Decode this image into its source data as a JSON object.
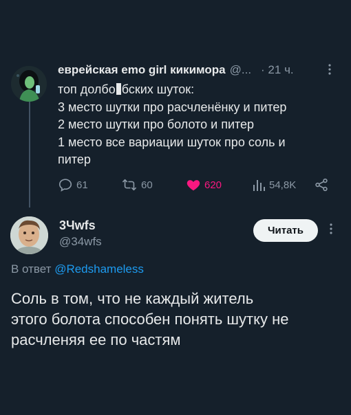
{
  "tweet1": {
    "author_name": "еврейская emo girl кикимора",
    "handle": "@...",
    "time": "· 21 ч.",
    "lines": [
      "топ долбо",
      "бских шуток:",
      "3 место шутки про расчленёнку и питер",
      "2 место шутки про болото и питер",
      "1 место все вариации шуток про соль и",
      "питер"
    ],
    "stats": {
      "replies": "61",
      "retweets": "60",
      "likes": "620",
      "views": "54,8K"
    },
    "liked": true,
    "icons": {
      "reply": "reply-icon",
      "retweet": "retweet-icon",
      "like": "heart-icon",
      "views": "views-icon",
      "share": "share-icon",
      "more": "more-icon"
    }
  },
  "tweet2": {
    "author_name": "3Чwfs",
    "handle": "@34wfs",
    "follow_label": "Читать",
    "reply_prefix": "В ответ",
    "reply_mention": "@Redshameless",
    "lines": [
      "Соль в том, что не каждый житель",
      "этого болота способен понять шутку не",
      "расчленяя ее по частям"
    ]
  },
  "colors": {
    "background": "#15202b",
    "text": "#e7e9ea",
    "muted": "#8b98a5",
    "link": "#1d9bf0",
    "like": "#f91880",
    "follow_button_bg": "#eff3f4"
  }
}
